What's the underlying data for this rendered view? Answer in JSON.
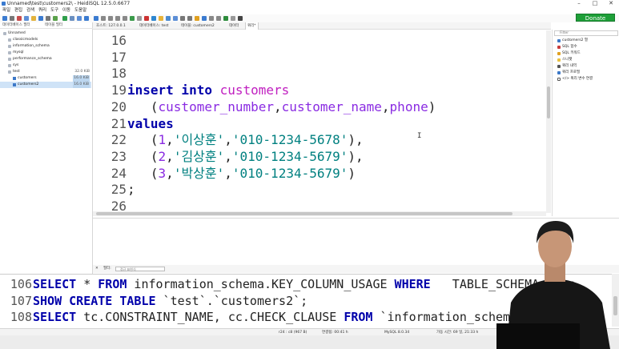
{
  "window": {
    "title": "Unnamed\\test\\customers2\\ - HeidiSQL 12.5.0.6677",
    "controls": [
      "–",
      "□",
      "✕"
    ]
  },
  "menu": [
    "파일",
    "편집",
    "검색",
    "쿼리",
    "도구",
    "이동",
    "도움말"
  ],
  "donate_label": "Donate",
  "left_panel": {
    "filter_db": "데이터베이스 필터",
    "filter_table": "테이블 필터",
    "tree": [
      {
        "label": "Unnamed",
        "size": "",
        "depth": 0,
        "icon": "server-icon"
      },
      {
        "label": "classicmodels",
        "size": "",
        "depth": 1,
        "icon": "database-icon"
      },
      {
        "label": "information_schema",
        "size": "",
        "depth": 1,
        "icon": "database-icon"
      },
      {
        "label": "mysql",
        "size": "",
        "depth": 1,
        "icon": "database-icon"
      },
      {
        "label": "performance_schema",
        "size": "",
        "depth": 1,
        "icon": "database-icon"
      },
      {
        "label": "sys",
        "size": "",
        "depth": 1,
        "icon": "database-icon"
      },
      {
        "label": "test",
        "size": "32.0 KiB",
        "depth": 1,
        "icon": "database-icon"
      },
      {
        "label": "customers",
        "size": "16.0 KiB",
        "depth": 2,
        "icon": "table-icon"
      },
      {
        "label": "customers2",
        "size": "16.0 KiB",
        "depth": 2,
        "icon": "table-icon",
        "selected": true
      }
    ]
  },
  "tabs": [
    {
      "label": "호스트: 127.0.0.1",
      "active": false
    },
    {
      "label": "데이터베이스: test",
      "active": false
    },
    {
      "label": "테이블: customers2",
      "active": false
    },
    {
      "label": "데이터",
      "active": false
    },
    {
      "label": "쿼리*",
      "active": true
    }
  ],
  "editor": {
    "lines": [
      {
        "n": "16",
        "parts": []
      },
      {
        "n": "17",
        "parts": []
      },
      {
        "n": "18",
        "parts": []
      },
      {
        "n": "19",
        "parts": [
          {
            "t": "insert into ",
            "c": "kw"
          },
          {
            "t": "customers",
            "c": "tbl"
          }
        ]
      },
      {
        "n": "20",
        "parts": [
          {
            "t": "   (",
            "c": "par"
          },
          {
            "t": "customer_number",
            "c": "col"
          },
          {
            "t": ",",
            "c": "par"
          },
          {
            "t": "customer_name",
            "c": "col"
          },
          {
            "t": ",",
            "c": "par"
          },
          {
            "t": "phone",
            "c": "col"
          },
          {
            "t": ")",
            "c": "par"
          }
        ]
      },
      {
        "n": "21",
        "parts": [
          {
            "t": "values",
            "c": "kw"
          }
        ]
      },
      {
        "n": "22",
        "parts": [
          {
            "t": "   (",
            "c": "par"
          },
          {
            "t": "1",
            "c": "col"
          },
          {
            "t": ",",
            "c": "par"
          },
          {
            "t": "'이상훈'",
            "c": "str"
          },
          {
            "t": ",",
            "c": "par"
          },
          {
            "t": "'010-1234-5678'",
            "c": "str"
          },
          {
            "t": "),",
            "c": "par"
          }
        ]
      },
      {
        "n": "23",
        "parts": [
          {
            "t": "   (",
            "c": "par"
          },
          {
            "t": "2",
            "c": "col"
          },
          {
            "t": ",",
            "c": "par"
          },
          {
            "t": "'김상훈'",
            "c": "str"
          },
          {
            "t": ",",
            "c": "par"
          },
          {
            "t": "'010-1234-5679'",
            "c": "str"
          },
          {
            "t": "),",
            "c": "par"
          }
        ]
      },
      {
        "n": "24",
        "parts": [
          {
            "t": "   (",
            "c": "par"
          },
          {
            "t": "3",
            "c": "col"
          },
          {
            "t": ",",
            "c": "par"
          },
          {
            "t": "'박상훈'",
            "c": "str"
          },
          {
            "t": ",",
            "c": "par"
          },
          {
            "t": "'010-1234-5679'",
            "c": "str"
          },
          {
            "t": ")",
            "c": "par"
          }
        ]
      },
      {
        "n": "25",
        "parts": [
          {
            "t": ";",
            "c": "par"
          }
        ]
      },
      {
        "n": "26",
        "parts": []
      }
    ]
  },
  "right_panel": {
    "filter_placeholder": "Filter",
    "items": [
      {
        "label": "customers2 열",
        "icon": "columns-icon",
        "color": "#3c78c8"
      },
      {
        "label": "SQL 함수",
        "icon": "function-icon",
        "color": "#c83c3c"
      },
      {
        "label": "SQL 키워드",
        "icon": "keyword-icon",
        "color": "#e0a020"
      },
      {
        "label": "스니펫",
        "icon": "folder-icon",
        "color": "#e8c040"
      },
      {
        "label": "쿼리 내역",
        "icon": "history-icon",
        "color": "#555555"
      },
      {
        "label": "쿼리 프로필",
        "icon": "profile-icon",
        "color": "#3c78c8"
      },
      {
        "label": "</> 쿼리 변수 연결",
        "icon": "checkbox-icon",
        "color": "#ffffff"
      }
    ]
  },
  "filter_bar": {
    "close": "✕",
    "label": "필터:",
    "placeholder": "정규 표현식"
  },
  "log": {
    "lines": [
      {
        "n": "106",
        "parts": [
          {
            "t": "SELECT",
            "c": "kw"
          },
          {
            "t": " * ",
            "c": "par"
          },
          {
            "t": "FROM",
            "c": "kw"
          },
          {
            "t": " information_schema.KEY_COLUMN_USAGE ",
            "c": "par"
          },
          {
            "t": "WHERE",
            "c": "kw"
          },
          {
            "t": "   TABLE_SCHEMA='tes",
            "c": "par"
          }
        ]
      },
      {
        "n": "107",
        "parts": [
          {
            "t": "SHOW CREATE TABLE",
            "c": "kw"
          },
          {
            "t": " `test`.`customers2`;",
            "c": "par"
          }
        ]
      },
      {
        "n": "108",
        "parts": [
          {
            "t": "SELECT",
            "c": "kw"
          },
          {
            "t": " tc.CONSTRAINT_NAME, cc.CHECK_CLAUSE ",
            "c": "par"
          },
          {
            "t": "FROM",
            "c": "kw"
          },
          {
            "t": " `information_schema`.`CHECK",
            "c": "par"
          }
        ]
      }
    ]
  },
  "status": {
    "pos": "r24 : c8 (967 B)",
    "connected": "연결됨: 00:41 h",
    "server": "MySQL 8.0.34",
    "uptime": "가동 시간: 69 일, 21:33 h"
  }
}
